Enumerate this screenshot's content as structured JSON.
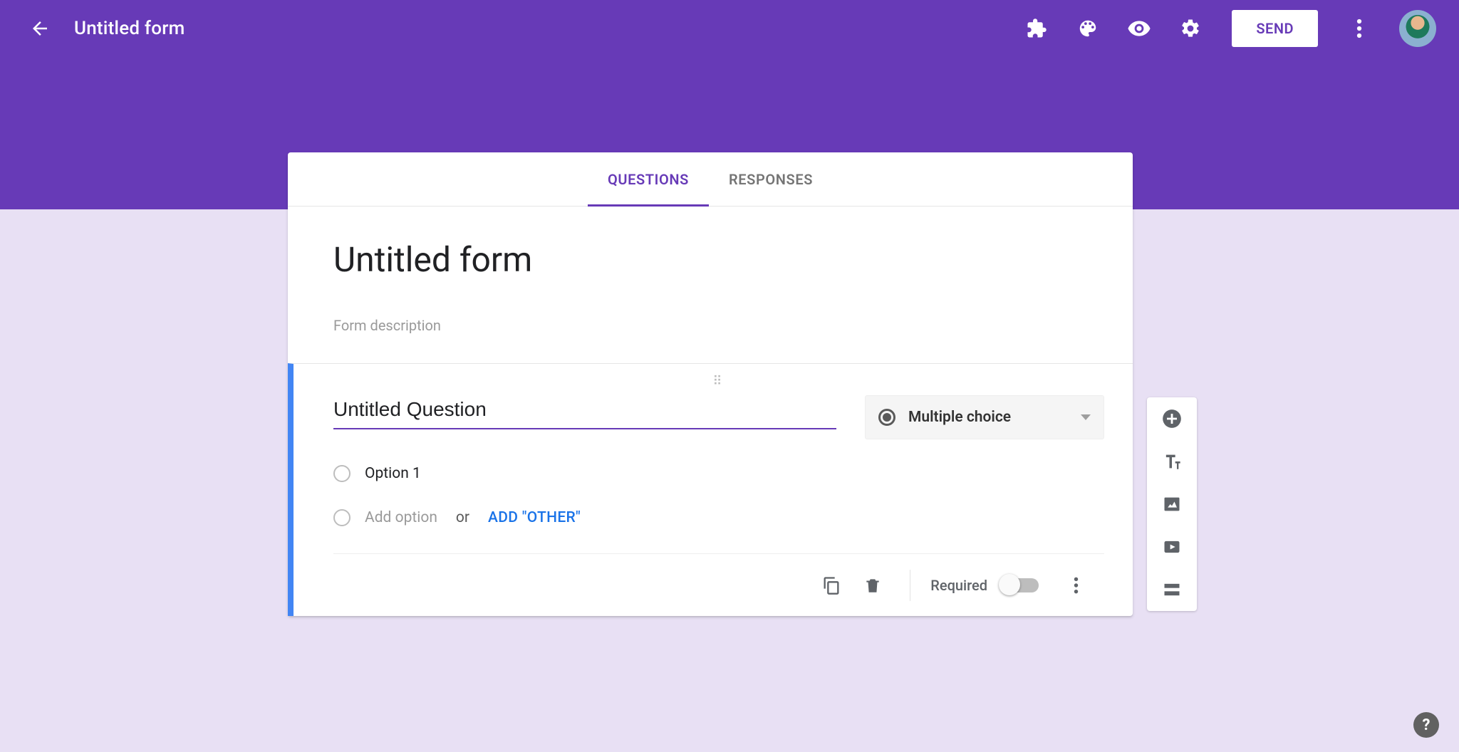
{
  "header": {
    "doc_title": "Untitled form",
    "send_label": "SEND"
  },
  "tabs": {
    "questions": "QUESTIONS",
    "responses": "RESPONSES"
  },
  "title_block": {
    "title": "Untitled form",
    "description_placeholder": "Form description"
  },
  "question": {
    "title": "Untitled Question",
    "type_label": "Multiple choice",
    "options": [
      {
        "label": "Option 1"
      }
    ],
    "add_option": "Add option",
    "or": "or",
    "add_other": "ADD \"OTHER\"",
    "required_label": "Required"
  }
}
